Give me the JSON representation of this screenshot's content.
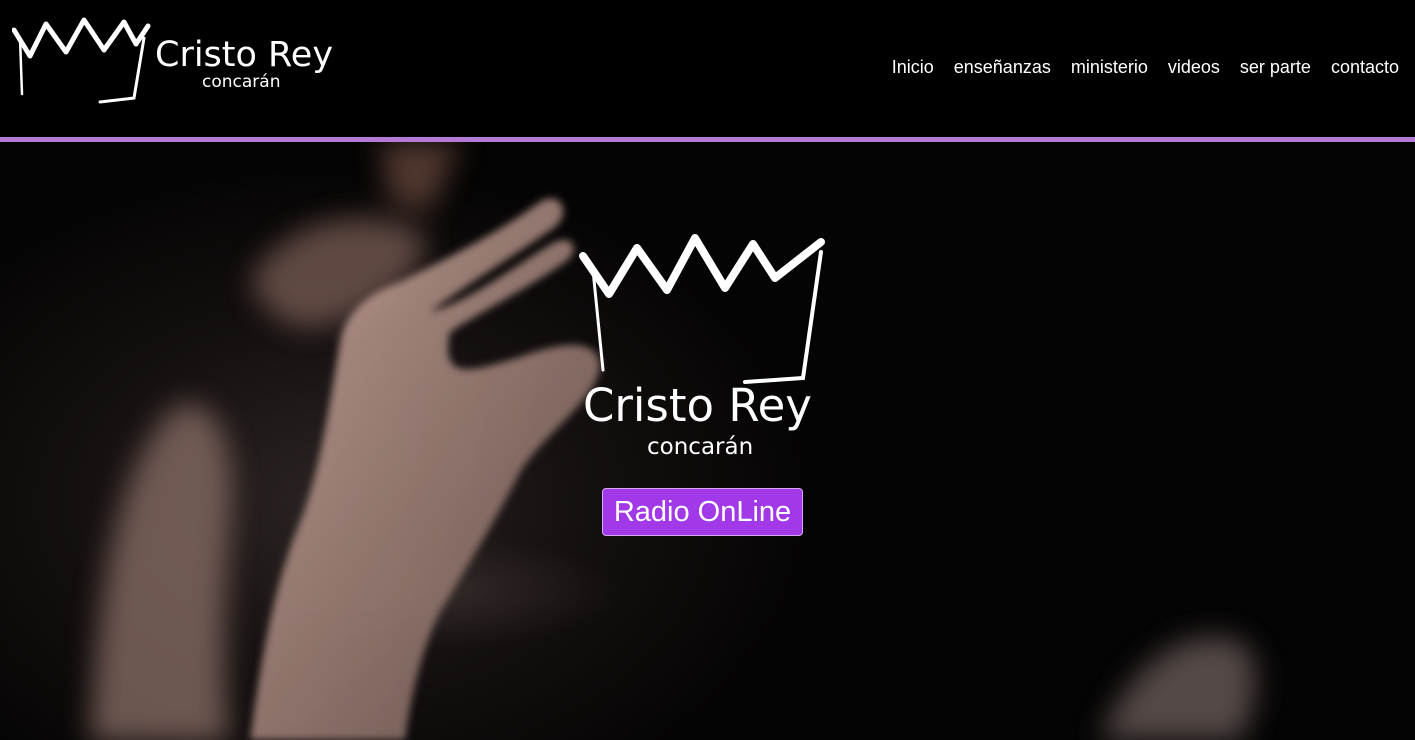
{
  "header": {
    "logo": {
      "name": "Cristo Rey",
      "subtitle": "concarán",
      "crown_icon": "crown-icon"
    },
    "nav": {
      "items": [
        {
          "label": "Inicio"
        },
        {
          "label": "enseñanzas"
        },
        {
          "label": "ministerio"
        },
        {
          "label": "videos"
        },
        {
          "label": "ser parte"
        },
        {
          "label": "contacto"
        }
      ]
    }
  },
  "hero": {
    "logo": {
      "name": "Cristo Rey",
      "subtitle": "concarán",
      "crown_icon": "crown-icon"
    },
    "button": {
      "label": "Radio OnLine"
    }
  },
  "colors": {
    "accent_line": "#b57ad6",
    "button_bg": "#a239e8",
    "background": "#000000"
  }
}
